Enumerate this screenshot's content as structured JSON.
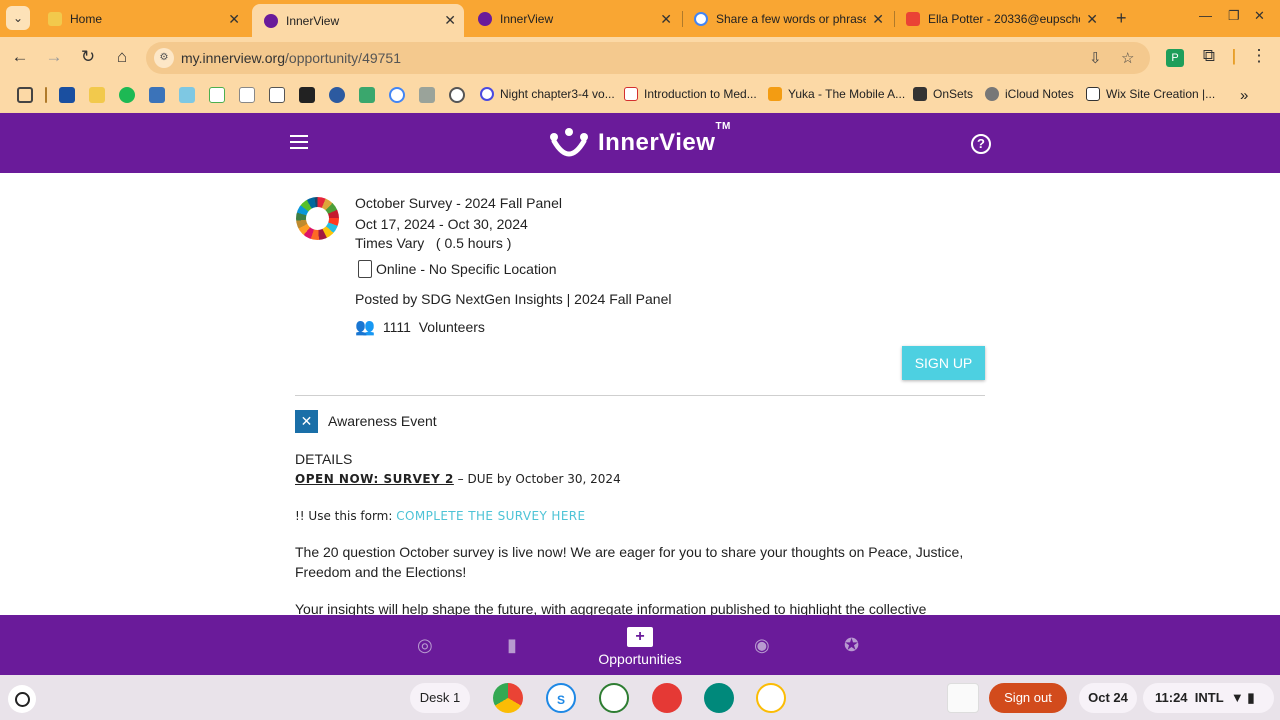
{
  "browser": {
    "tabs": [
      {
        "title": "Home",
        "active": false
      },
      {
        "title": "InnerView",
        "active": true
      },
      {
        "title": "InnerView",
        "active": false
      },
      {
        "title": "Share a few words or phrase",
        "active": false
      },
      {
        "title": "Ella Potter - 20336@eupscho",
        "active": false
      }
    ],
    "url_host": "my.innerview.org",
    "url_path": "/opportunity/49751",
    "bookmarks": [
      {
        "label": "Night chapter3-4 vo..."
      },
      {
        "label": "Introduction to Med..."
      },
      {
        "label": "Yuka - The Mobile A..."
      },
      {
        "label": "OnSets"
      },
      {
        "label": "iCloud Notes"
      },
      {
        "label": "Wix Site Creation |..."
      }
    ]
  },
  "app": {
    "brand": "InnerView",
    "trademark": "TM",
    "help_glyph": "?"
  },
  "opportunity": {
    "title": "October Survey - 2024 Fall Panel",
    "dates": "Oct 17, 2024 - Oct 30, 2024",
    "times": "Times Vary",
    "duration": "( 0.5 hours )",
    "location": "Online - No Specific Location",
    "posted_by": "Posted by SDG NextGen Insights | 2024 Fall Panel",
    "volunteer_count": "1111",
    "volunteer_label": "Volunteers",
    "signup_label": "SIGN UP",
    "category": "Awareness Event",
    "details_heading": "DETAILS",
    "open_now_bold": "OPEN NOW: SURVEY 2",
    "open_now_rest": " – DUE by October 30, 2024",
    "form_prefix": "!! Use this form: ",
    "form_link": "COMPLETE THE SURVEY HERE",
    "paragraph1": "The 20 question October survey is live now! We are eager for you to share your thoughts on Peace, Justice, Freedom and the Elections!",
    "paragraph2": "Your insights will help shape the future, with aggregate information published to highlight the collective"
  },
  "bottom_nav": {
    "active_label": "Opportunities"
  },
  "shelf": {
    "desk_label": "Desk 1",
    "signout_label": "Sign out",
    "date": "Oct 24",
    "time": "11:24",
    "input_method": "INTL"
  },
  "colors": {
    "tab_strip": "#f9a633",
    "toolbar": "#fcd9a6",
    "app_purple": "#6a1b9a",
    "signup_cyan": "#4dd0e1",
    "signout_orange": "#d24b1c"
  }
}
